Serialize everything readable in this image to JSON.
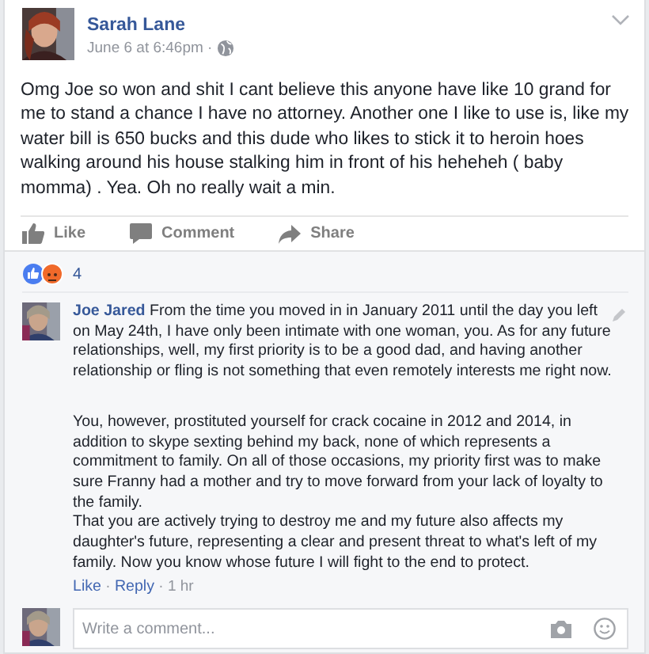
{
  "post": {
    "author": "Sarah Lane",
    "time": "June 6 at 6:46pm · ",
    "text": "Omg Joe so won and shit I cant believe this anyone have like 10 grand for me to stand a chance I have no attorney. Another one I like to use is, like my water bill is 650 bucks and this dude who likes to stick it to heroin hoes walking around his house stalking him in front of his heheheh ( baby momma) . Yea. Oh no really wait a min."
  },
  "actions": [
    {
      "kind": "like",
      "label": "Like"
    },
    {
      "kind": "comment",
      "label": "Comment"
    },
    {
      "kind": "share",
      "label": "Share"
    }
  ],
  "reactions": {
    "count": "4"
  },
  "comment": {
    "author": "Joe Jared",
    "paragraphs": [
      "From the time you moved in in January 2011 until the day you left on May 24th, I have only been intimate with one woman, you. As for any future relationships, well, my first priority is to be a good dad, and having another relationship or fling is not something that even remotely interests me right now.",
      "You, however, prostituted yourself for crack cocaine in 2012 and 2014, in addition to skype sexting behind my back, none of which represents a commitment to family. On all of those occasions, my priority first was to make sure Franny had a mother and try to move forward from your lack of loyalty to the family.",
      "That you are actively trying to destroy me and my future also affects my daughter's future, representing a clear and present threat to what's left of my family. Now you know whose future I will fight to the end to protect."
    ],
    "like": "Like",
    "separator_1": "·",
    "reply": "Reply",
    "separator_2": "·",
    "time": "1 hr"
  },
  "composer": {
    "placeholder": "Write a comment..."
  }
}
